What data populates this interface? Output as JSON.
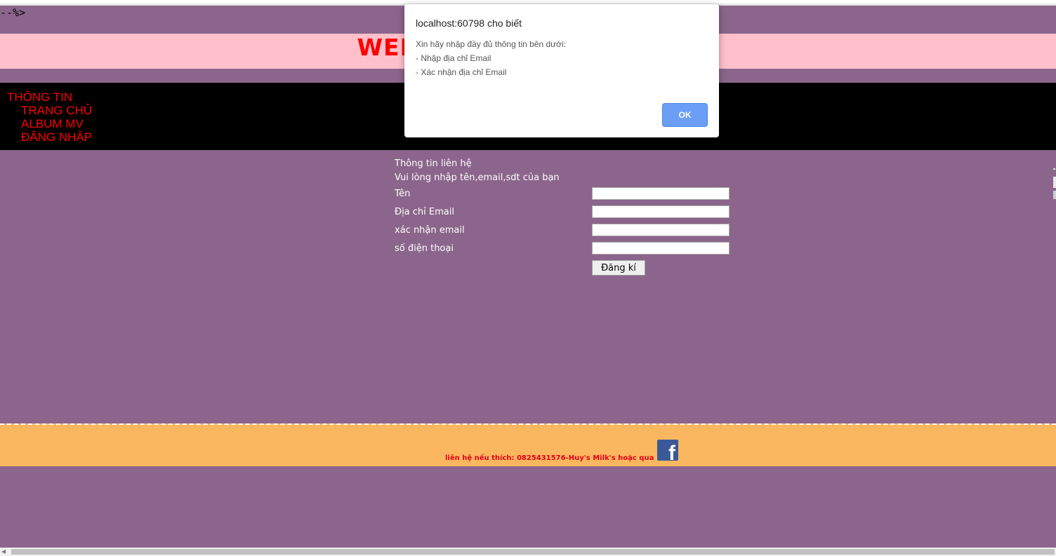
{
  "page": {
    "stray_text": "--%>",
    "banner_title": "WELCOME TO MY WORLD",
    "nav": {
      "heading": "THÔNG TIN",
      "items": [
        {
          "label": "TRANG CHỦ"
        },
        {
          "label": "ALBUM MV"
        },
        {
          "label": "ĐĂNG NHẬP"
        }
      ]
    },
    "form": {
      "heading": "Thông tin liên hệ",
      "subheading": "Vui lòng nhập tên,email,sdt của bạn",
      "fields": [
        {
          "label": "Tên",
          "value": ""
        },
        {
          "label": "Địa chỉ Email",
          "value": ""
        },
        {
          "label": "xác nhận email",
          "value": ""
        },
        {
          "label": "số điện thoại",
          "value": ""
        }
      ],
      "submit_label": "Đăng kí"
    },
    "footer": {
      "text": "liên hệ nếu thích: 0825431576-Huy's Milk's hoặc qua",
      "fb_icon": "facebook-icon",
      "fb_glyph": "f"
    }
  },
  "dialog": {
    "title": "localhost:60798 cho biết",
    "lines": [
      "Xin hãy nhập đầy đủ thông tin bên dưới:",
      "- Nhập địa chỉ Email",
      "- Xác nhận địa chỉ Email"
    ],
    "ok_label": "OK"
  },
  "colors": {
    "page_background": "#8b658b",
    "banner_background": "#ffc0cb",
    "banner_text": "#ff0000",
    "nav_background": "#000000",
    "nav_text": "#ff0000",
    "footer_background": "#fbb75f",
    "footer_text": "#e0001a",
    "dialog_button": "#6a9ff5"
  }
}
